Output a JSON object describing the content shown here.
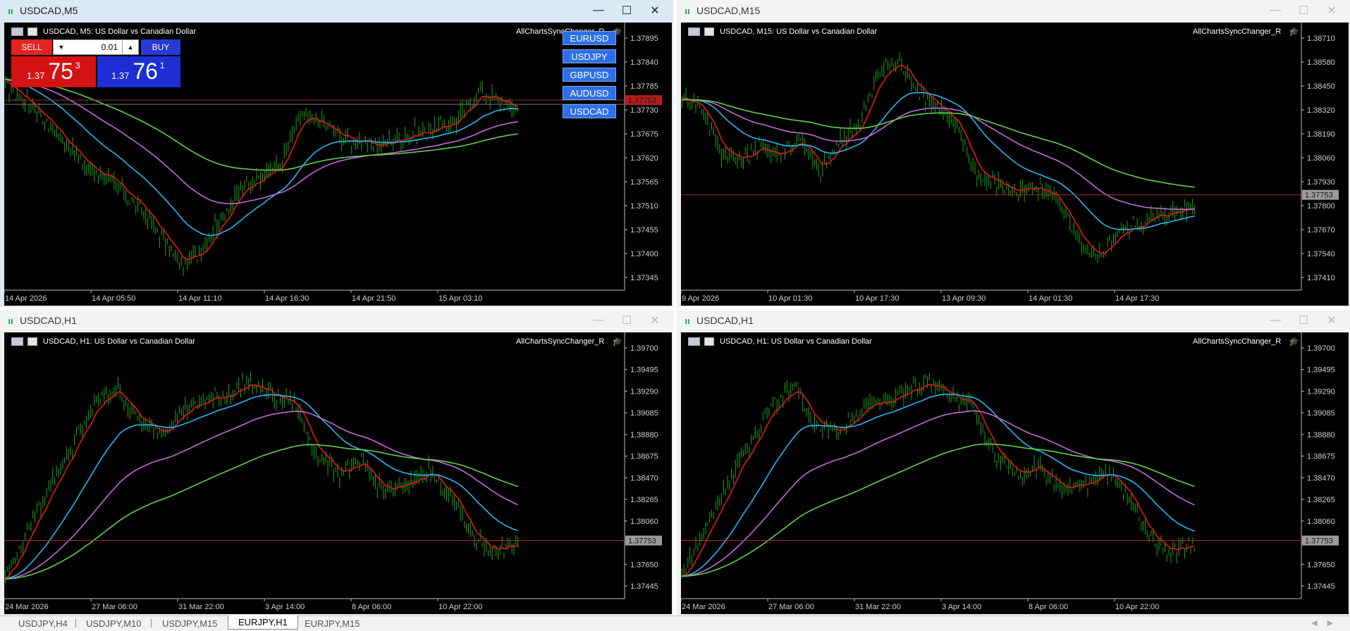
{
  "windows": [
    {
      "id": "w1",
      "active": true,
      "title": "USDCAD,M5",
      "label": "USDCAD, M5:  US Dollar vs Canadian Dollar",
      "indicator": "AllChartsSyncChanger_R",
      "y_ticks": [
        "1.37895",
        "1.37840",
        "1.37785",
        "1.37730",
        "1.37675",
        "1.37620",
        "1.37565",
        "1.37510",
        "1.37455",
        "1.37400",
        "1.37345"
      ],
      "x_ticks": [
        "14 Apr 2026",
        "14 Apr 05:50",
        "14 Apr 11:10",
        "14 Apr 16:30",
        "14 Apr 21:50",
        "15 Apr 03:10"
      ],
      "bid_label": "1.37753",
      "ask_label": "1.37753",
      "price_colors": {
        "bid": "#c92020",
        "ask": "#8a8a8a"
      }
    },
    {
      "id": "w2",
      "active": false,
      "title": "USDCAD,M15",
      "label": "USDCAD, M15:  US Dollar vs Canadian Dollar",
      "indicator": "AllChartsSyncChanger_R",
      "y_ticks": [
        "1.38710",
        "1.38580",
        "1.38450",
        "1.38320",
        "1.38190",
        "1.38060",
        "1.37930",
        "1.37800",
        "1.37670",
        "1.37540",
        "1.37410"
      ],
      "x_ticks": [
        "9 Apr 2026",
        "10 Apr 01:30",
        "10 Apr 17:30",
        "13 Apr 09:30",
        "14 Apr 01:30",
        "14 Apr 17:30"
      ],
      "bid_label": "1.37753"
    },
    {
      "id": "w3",
      "active": false,
      "title": "USDCAD,H1",
      "label": "USDCAD, H1:  US Dollar vs Canadian Dollar",
      "indicator": "AllChartsSyncChanger_R",
      "y_ticks": [
        "1.39700",
        "1.39495",
        "1.39290",
        "1.39085",
        "1.38880",
        "1.38675",
        "1.38470",
        "1.38265",
        "1.38060",
        "1.37855",
        "1.37650",
        "1.37445"
      ],
      "x_ticks": [
        "24 Mar 2026",
        "27 Mar 06:00",
        "31 Mar 22:00",
        "3 Apr 14:00",
        "8 Apr 06:00",
        "10 Apr 22:00"
      ],
      "bid_label": "1.37753"
    },
    {
      "id": "w4",
      "active": false,
      "title": "USDCAD,H1",
      "label": "USDCAD, H1:  US Dollar vs Canadian Dollar",
      "indicator": "AllChartsSyncChanger_R",
      "y_ticks": [
        "1.39700",
        "1.39495",
        "1.39290",
        "1.39085",
        "1.38880",
        "1.38675",
        "1.38470",
        "1.38265",
        "1.38060",
        "1.37855",
        "1.37650",
        "1.37445"
      ],
      "x_ticks": [
        "24 Mar 2026",
        "27 Mar 06:00",
        "31 Mar 22:00",
        "3 Apr 14:00",
        "8 Apr 06:00",
        "10 Apr 22:00"
      ],
      "bid_label": "1.37753"
    }
  ],
  "trade_panel": {
    "sell_label": "SELL",
    "buy_label": "BUY",
    "lot": "0.01",
    "sell_price": {
      "prefix": "1.37",
      "big": "75",
      "sup": "3"
    },
    "buy_price": {
      "prefix": "1.37",
      "big": "76",
      "sup": "1"
    }
  },
  "symbol_buttons": [
    "EURUSD",
    "USDJPY",
    "GBPUSD",
    "AUDUSD",
    "USDCAD"
  ],
  "tabs": [
    "USDJPY,H4",
    "USDJPY,M10",
    "USDJPY,M15",
    "EURJPY,H1",
    "EURJPY,M15"
  ],
  "active_tab": 3,
  "colors": {
    "candles": "#1fa31f",
    "ma_fast": "#e01b1b",
    "ma_mid": "#27b6f0",
    "ma_slow": "#c26ad6",
    "ma_long": "#5fd14a",
    "price_line": "#9b3030",
    "axis_text": "#cfcfcf"
  },
  "icons": {
    "window": "chart-bars-icon",
    "minimize": "minimize-icon",
    "maximize": "maximize-icon",
    "close": "close-icon",
    "indicator": "graduation-cap-icon"
  }
}
